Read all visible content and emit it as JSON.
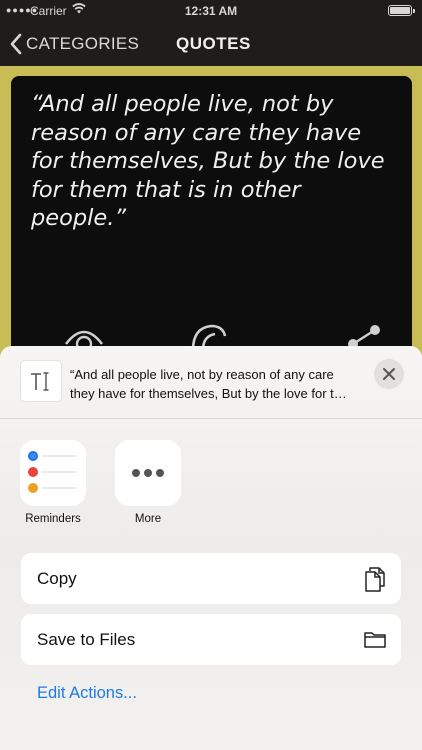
{
  "status_bar": {
    "carrier": "Carrier",
    "time": "12:31 AM"
  },
  "nav": {
    "back_label": "CATEGORIES",
    "title": "QUOTES"
  },
  "quote": {
    "lines": [
      "“And all people live, not by",
      "reason of any care they have",
      "for themselves, But by the love",
      "for them that is in other",
      "people.”"
    ]
  },
  "share_sheet": {
    "preview_line1": "“And all people live, not by reason of any care",
    "preview_line2": "they have for themselves, But by the love for t…",
    "apps": [
      {
        "label": "Reminders",
        "icon": "reminders-icon"
      },
      {
        "label": "More",
        "icon": "more-icon"
      }
    ],
    "actions": [
      {
        "label": "Copy",
        "icon": "copy-icon"
      },
      {
        "label": "Save to Files",
        "icon": "folder-icon"
      }
    ],
    "edit_actions_label": "Edit Actions..."
  },
  "colors": {
    "background": "#c8bd54",
    "card": "#0d0d0d",
    "link": "#1d7be5",
    "reminder_dots": [
      "#1a73e8",
      "#e8443a",
      "#f0a020"
    ]
  }
}
